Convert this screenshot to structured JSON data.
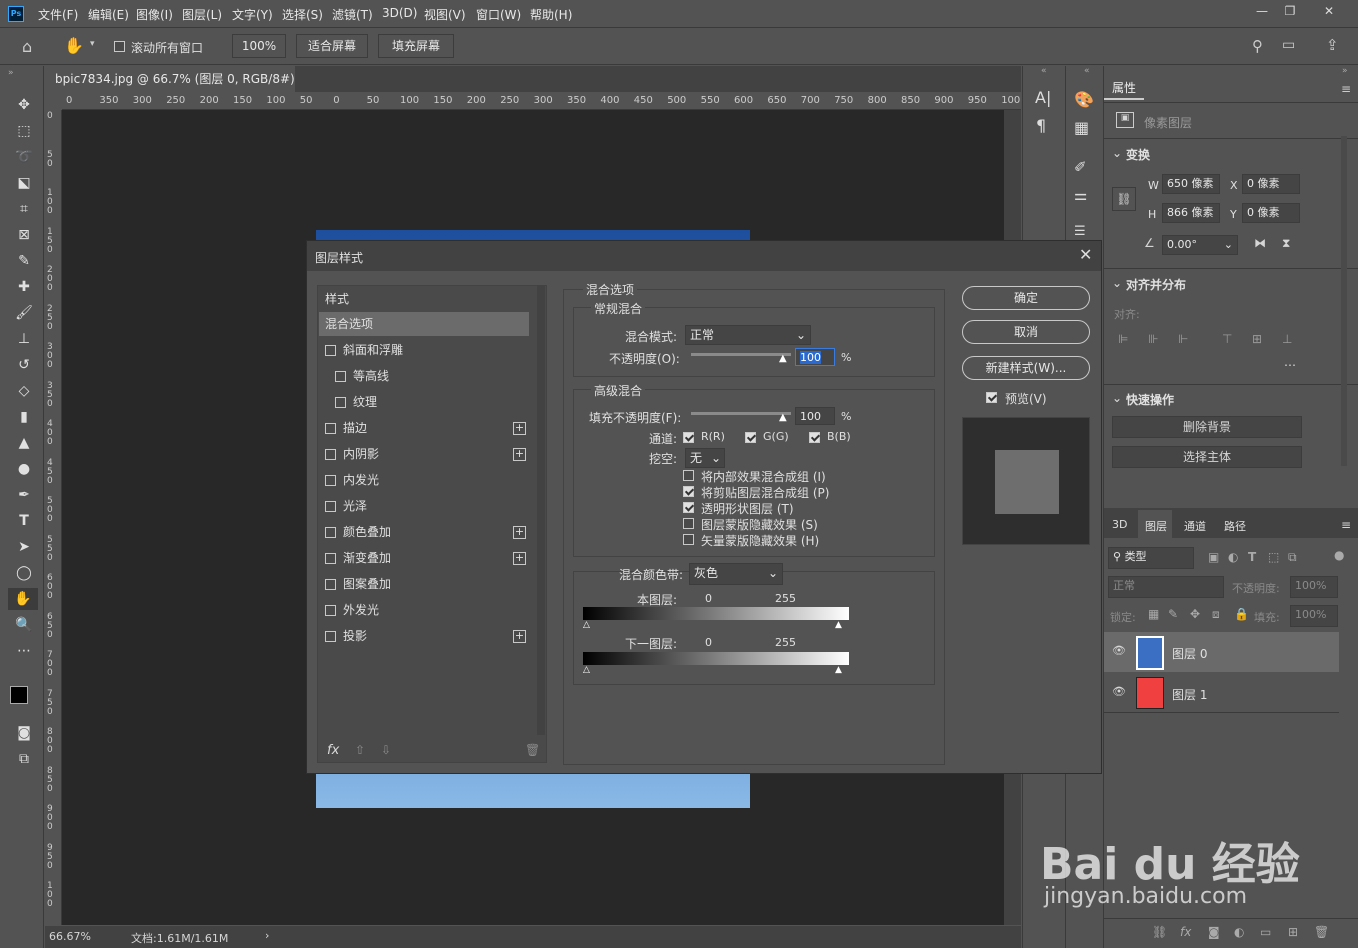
{
  "menubar": {
    "logo": "Ps",
    "items": [
      "文件(F)",
      "编辑(E)",
      "图像(I)",
      "图层(L)",
      "文字(Y)",
      "选择(S)",
      "滤镜(T)",
      "3D(D)",
      "视图(V)",
      "窗口(W)",
      "帮助(H)"
    ]
  },
  "optbar": {
    "scroll_all": "滚动所有窗口",
    "zoom": "100%",
    "fit_screen": "适合屏幕",
    "fill_screen": "填充屏幕"
  },
  "document": {
    "tab_title": "bpic7834.jpg @ 66.7% (图层 0, RGB/8#) *",
    "ruler_h": [
      "0",
      "350",
      "300",
      "250",
      "200",
      "150",
      "100",
      "50",
      "0",
      "50",
      "100",
      "150",
      "200",
      "250",
      "300",
      "350",
      "400",
      "450",
      "500",
      "550",
      "600",
      "650",
      "700",
      "750",
      "800",
      "850",
      "900",
      "950",
      "100"
    ],
    "ruler_v": [
      "0",
      "5 0",
      "1 0 0",
      "1 5 0",
      "2 0 0",
      "2 5 0",
      "3 0 0",
      "3 5 0",
      "4 0 0",
      "4 5 0",
      "5 0 0",
      "5 5 0",
      "6 0 0",
      "6 5 0",
      "7 0 0",
      "7 5 0",
      "8 0 0",
      "8 5 0",
      "9 0 0",
      "9 5 0",
      "1 0 0"
    ],
    "zoom_status": "66.67%",
    "doc_status": "文档:1.61M/1.61M"
  },
  "dialog": {
    "title": "图层样式",
    "styles_header": "样式",
    "blend_options": "混合选项",
    "style_items": [
      {
        "label": "斜面和浮雕",
        "plus": false
      },
      {
        "label": "等高线",
        "plus": false,
        "indent": true
      },
      {
        "label": "纹理",
        "plus": false,
        "indent": true
      },
      {
        "label": "描边",
        "plus": true
      },
      {
        "label": "内阴影",
        "plus": true
      },
      {
        "label": "内发光",
        "plus": false
      },
      {
        "label": "光泽",
        "plus": false
      },
      {
        "label": "颜色叠加",
        "plus": true
      },
      {
        "label": "渐变叠加",
        "plus": true
      },
      {
        "label": "图案叠加",
        "plus": false
      },
      {
        "label": "外发光",
        "plus": false
      },
      {
        "label": "投影",
        "plus": true
      }
    ],
    "fx_label": "fx",
    "section_title": "混合选项",
    "general": {
      "title": "常规混合",
      "mode_label": "混合模式:",
      "mode_value": "正常",
      "opacity_label": "不透明度(O):",
      "opacity_value": "100",
      "percent": "%"
    },
    "advanced": {
      "title": "高级混合",
      "fill_label": "填充不透明度(F):",
      "fill_value": "100",
      "percent": "%",
      "channels_label": "通道:",
      "ch_r": "R(R)",
      "ch_g": "G(G)",
      "ch_b": "B(B)",
      "knockout_label": "挖空:",
      "knockout_value": "无",
      "options": [
        {
          "label": "将内部效果混合成组 (I)",
          "checked": false
        },
        {
          "label": "将剪贴图层混合成组 (P)",
          "checked": true
        },
        {
          "label": "透明形状图层 (T)",
          "checked": true
        },
        {
          "label": "图层蒙版隐藏效果 (S)",
          "checked": false
        },
        {
          "label": "矢量蒙版隐藏效果 (H)",
          "checked": false
        }
      ]
    },
    "blend_if": {
      "label": "混合颜色带:",
      "value": "灰色",
      "this_layer": "本图层:",
      "under_layer": "下一图层:",
      "low": "0",
      "high": "255"
    },
    "buttons": {
      "ok": "确定",
      "cancel": "取消",
      "new_style": "新建样式(W)...",
      "preview": "预览(V)"
    }
  },
  "properties": {
    "tab": "属性",
    "pixel_layer": "像素图层",
    "transform": "变换",
    "w_label": "W",
    "w_value": "650 像素",
    "h_label": "H",
    "h_value": "866 像素",
    "x_label": "X",
    "x_value": "0 像素",
    "y_label": "Y",
    "y_value": "0 像素",
    "angle_value": "0.00°",
    "align_title": "对齐并分布",
    "align_label": "对齐:",
    "quick_title": "快速操作",
    "remove_bg": "删除背景",
    "select_subject": "选择主体"
  },
  "layers": {
    "tabs": [
      "3D",
      "图层",
      "通道",
      "路径"
    ],
    "filter_label": "类型",
    "mode": "正常",
    "opacity_label": "不透明度:",
    "opacity_value": "100%",
    "lock_label": "锁定:",
    "fill_label": "填充:",
    "fill_value": "100%",
    "items": [
      {
        "name": "图层 0",
        "color": "#3a6fc4"
      },
      {
        "name": "图层 1",
        "color": "#f04040"
      }
    ]
  },
  "watermark": {
    "brand": "Bai du 经验",
    "url": "jingyan.baidu.com"
  }
}
